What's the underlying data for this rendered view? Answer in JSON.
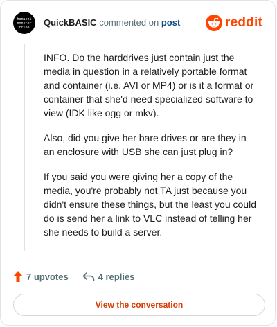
{
  "comment": {
    "avatar_lines": [
      "hamachi",
      "monster",
      "tribe"
    ],
    "author": "QuickBASIC",
    "action": "commented on",
    "target": "post",
    "paragraphs": [
      "INFO. Do the harddrives just contain just the media in question in a relatively portable format and container (i.e. AVI or MP4) or is it a format or container that she'd need specialized software to view (IDK like ogg or mkv).",
      "Also, did you give her bare drives or are they in an enclosure with USB she can just plug in?",
      "If you said you were giving her a copy of the media, you're probably not TA just because you didn't ensure these things, but the least you could do is send her a link to VLC instead of telling her she needs to build a server."
    ]
  },
  "brand": {
    "name": "reddit",
    "logo_icon": "reddit-snoo-icon",
    "color": "#ff4500"
  },
  "actions": {
    "upvotes_label": "7 upvotes",
    "upvote_icon": "upvote-arrow-icon",
    "upvote_color": "#ff4500",
    "replies_label": "4 replies",
    "reply_icon": "reply-arrow-icon"
  },
  "footer": {
    "button_label": "View the conversation",
    "button_color": "#d93a00"
  }
}
